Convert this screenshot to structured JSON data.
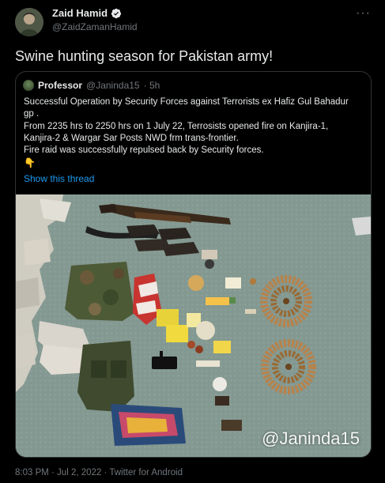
{
  "tweet": {
    "author_name": "Zaid Hamid",
    "author_handle": "@ZaidZamanHamid",
    "more_icon": "more-dots-icon",
    "text": "Swine hunting season for Pakistan army!",
    "footer": "8:03 PM · Jul 2, 2022 · Twitter for Android"
  },
  "quote": {
    "author_name": "Professor",
    "author_handle": "@Janinda15",
    "time": "· 5h",
    "lines": [
      "Successful Operation by Security Forces against Terrorists ex Hafiz Gul Bahadur",
      "gp .",
      "From 2235 hrs to 2250 hrs on 1 July 22, Terrosists opened fire on Kanjira-1,",
      "Kanjira-2 & Wargar Sar Posts NWD frm trans-frontier.",
      "Fire raid was successfully repulsed back by Security forces.",
      "👇"
    ],
    "show_thread": "Show this thread",
    "watermark": "@Janinda15"
  },
  "colors": {
    "background": "#000000",
    "text": "#e7e9ea",
    "muted": "#71767b",
    "link": "#1d9bf0",
    "border": "#2f3336",
    "verified": "#e7e9ea"
  }
}
